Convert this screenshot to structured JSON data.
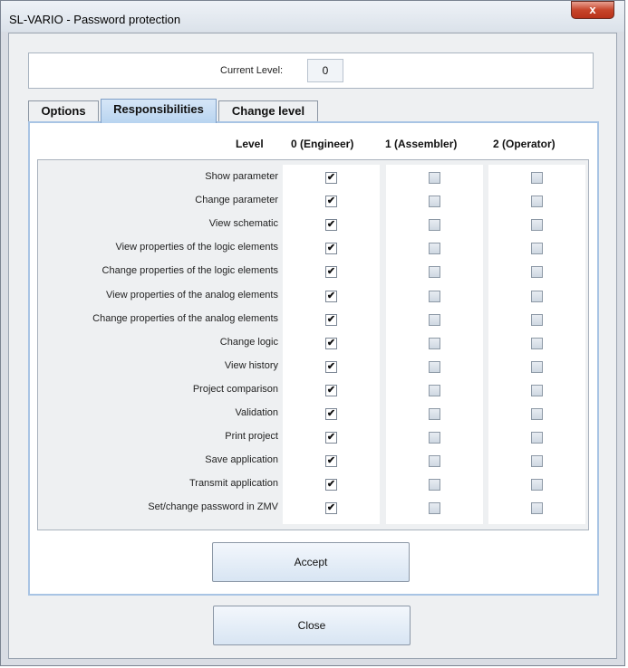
{
  "window": {
    "title": "SL-VARIO - Password protection",
    "close_glyph": "x"
  },
  "current_level": {
    "label": "Current Level:",
    "value": "0"
  },
  "tabs": [
    {
      "label": "Options",
      "active": false
    },
    {
      "label": "Responsibilities",
      "active": true
    },
    {
      "label": "Change level",
      "active": false
    }
  ],
  "table": {
    "headers": {
      "level": "Level",
      "col0": "0 (Engineer)",
      "col1": "1 (Assembler)",
      "col2": "2 (Operator)"
    },
    "rows": [
      {
        "label": "Show parameter",
        "checks": [
          true,
          false,
          false
        ]
      },
      {
        "label": "Change parameter",
        "checks": [
          true,
          false,
          false
        ]
      },
      {
        "label": "View schematic",
        "checks": [
          true,
          false,
          false
        ]
      },
      {
        "label": "View properties of the logic elements",
        "checks": [
          true,
          false,
          false
        ]
      },
      {
        "label": "Change properties of the logic elements",
        "checks": [
          true,
          false,
          false
        ]
      },
      {
        "label": "View properties of the analog elements",
        "checks": [
          true,
          false,
          false
        ]
      },
      {
        "label": "Change properties of the analog elements",
        "checks": [
          true,
          false,
          false
        ]
      },
      {
        "label": "Change logic",
        "checks": [
          true,
          false,
          false
        ]
      },
      {
        "label": "View history",
        "checks": [
          true,
          false,
          false
        ]
      },
      {
        "label": "Project comparison",
        "checks": [
          true,
          false,
          false
        ]
      },
      {
        "label": "Validation",
        "checks": [
          true,
          false,
          false
        ]
      },
      {
        "label": "Print project",
        "checks": [
          true,
          false,
          false
        ]
      },
      {
        "label": "Save application",
        "checks": [
          true,
          false,
          false
        ]
      },
      {
        "label": "Transmit application",
        "checks": [
          true,
          false,
          false
        ]
      },
      {
        "label": "Set/change password in ZMV",
        "checks": [
          true,
          false,
          false
        ]
      }
    ]
  },
  "buttons": {
    "accept": "Accept",
    "close": "Close"
  },
  "checkmark_glyph": "✔",
  "colors": {
    "active_tab": "#b8d4f0",
    "close_button": "#c7452b",
    "panel_border": "#a8c4e4"
  }
}
